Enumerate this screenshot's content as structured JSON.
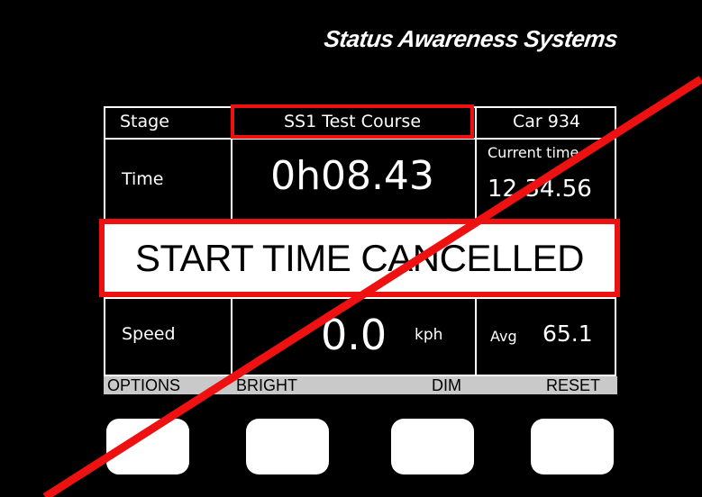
{
  "header": {
    "brand": "Status Awareness Systems"
  },
  "display": {
    "stage_label": "Stage",
    "stage_name": "SS1 Test Course",
    "car": "Car 934",
    "time_label": "Time",
    "elapsed_time": "0h08.43",
    "current_time_label": "Current time",
    "current_time": "12.34.56",
    "banner": "START TIME CANCELLED",
    "speed_label": "Speed",
    "speed_value": "0.0",
    "speed_unit": "kph",
    "avg_label": "Avg",
    "avg_value": "65.1"
  },
  "softkeys": {
    "options": "OPTIONS",
    "bright": "BRIGHT",
    "dim": "DIM",
    "reset": "RESET"
  },
  "colors": {
    "background": "#000000",
    "alert_red": "#ee1111",
    "softkey_bar": "#c9c9c9"
  }
}
